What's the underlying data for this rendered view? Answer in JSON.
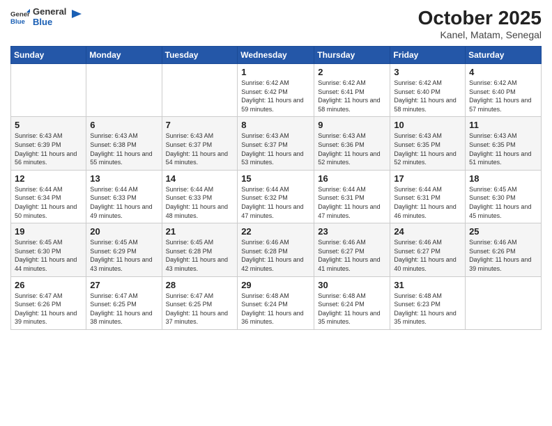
{
  "logo": {
    "general": "General",
    "blue": "Blue"
  },
  "title": "October 2025",
  "location": "Kanel, Matam, Senegal",
  "weekdays": [
    "Sunday",
    "Monday",
    "Tuesday",
    "Wednesday",
    "Thursday",
    "Friday",
    "Saturday"
  ],
  "weeks": [
    [
      {
        "day": "",
        "info": ""
      },
      {
        "day": "",
        "info": ""
      },
      {
        "day": "",
        "info": ""
      },
      {
        "day": "1",
        "info": "Sunrise: 6:42 AM\nSunset: 6:42 PM\nDaylight: 11 hours and 59 minutes."
      },
      {
        "day": "2",
        "info": "Sunrise: 6:42 AM\nSunset: 6:41 PM\nDaylight: 11 hours and 58 minutes."
      },
      {
        "day": "3",
        "info": "Sunrise: 6:42 AM\nSunset: 6:40 PM\nDaylight: 11 hours and 58 minutes."
      },
      {
        "day": "4",
        "info": "Sunrise: 6:42 AM\nSunset: 6:40 PM\nDaylight: 11 hours and 57 minutes."
      }
    ],
    [
      {
        "day": "5",
        "info": "Sunrise: 6:43 AM\nSunset: 6:39 PM\nDaylight: 11 hours and 56 minutes."
      },
      {
        "day": "6",
        "info": "Sunrise: 6:43 AM\nSunset: 6:38 PM\nDaylight: 11 hours and 55 minutes."
      },
      {
        "day": "7",
        "info": "Sunrise: 6:43 AM\nSunset: 6:37 PM\nDaylight: 11 hours and 54 minutes."
      },
      {
        "day": "8",
        "info": "Sunrise: 6:43 AM\nSunset: 6:37 PM\nDaylight: 11 hours and 53 minutes."
      },
      {
        "day": "9",
        "info": "Sunrise: 6:43 AM\nSunset: 6:36 PM\nDaylight: 11 hours and 52 minutes."
      },
      {
        "day": "10",
        "info": "Sunrise: 6:43 AM\nSunset: 6:35 PM\nDaylight: 11 hours and 52 minutes."
      },
      {
        "day": "11",
        "info": "Sunrise: 6:43 AM\nSunset: 6:35 PM\nDaylight: 11 hours and 51 minutes."
      }
    ],
    [
      {
        "day": "12",
        "info": "Sunrise: 6:44 AM\nSunset: 6:34 PM\nDaylight: 11 hours and 50 minutes."
      },
      {
        "day": "13",
        "info": "Sunrise: 6:44 AM\nSunset: 6:33 PM\nDaylight: 11 hours and 49 minutes."
      },
      {
        "day": "14",
        "info": "Sunrise: 6:44 AM\nSunset: 6:33 PM\nDaylight: 11 hours and 48 minutes."
      },
      {
        "day": "15",
        "info": "Sunrise: 6:44 AM\nSunset: 6:32 PM\nDaylight: 11 hours and 47 minutes."
      },
      {
        "day": "16",
        "info": "Sunrise: 6:44 AM\nSunset: 6:31 PM\nDaylight: 11 hours and 47 minutes."
      },
      {
        "day": "17",
        "info": "Sunrise: 6:44 AM\nSunset: 6:31 PM\nDaylight: 11 hours and 46 minutes."
      },
      {
        "day": "18",
        "info": "Sunrise: 6:45 AM\nSunset: 6:30 PM\nDaylight: 11 hours and 45 minutes."
      }
    ],
    [
      {
        "day": "19",
        "info": "Sunrise: 6:45 AM\nSunset: 6:30 PM\nDaylight: 11 hours and 44 minutes."
      },
      {
        "day": "20",
        "info": "Sunrise: 6:45 AM\nSunset: 6:29 PM\nDaylight: 11 hours and 43 minutes."
      },
      {
        "day": "21",
        "info": "Sunrise: 6:45 AM\nSunset: 6:28 PM\nDaylight: 11 hours and 43 minutes."
      },
      {
        "day": "22",
        "info": "Sunrise: 6:46 AM\nSunset: 6:28 PM\nDaylight: 11 hours and 42 minutes."
      },
      {
        "day": "23",
        "info": "Sunrise: 6:46 AM\nSunset: 6:27 PM\nDaylight: 11 hours and 41 minutes."
      },
      {
        "day": "24",
        "info": "Sunrise: 6:46 AM\nSunset: 6:27 PM\nDaylight: 11 hours and 40 minutes."
      },
      {
        "day": "25",
        "info": "Sunrise: 6:46 AM\nSunset: 6:26 PM\nDaylight: 11 hours and 39 minutes."
      }
    ],
    [
      {
        "day": "26",
        "info": "Sunrise: 6:47 AM\nSunset: 6:26 PM\nDaylight: 11 hours and 39 minutes."
      },
      {
        "day": "27",
        "info": "Sunrise: 6:47 AM\nSunset: 6:25 PM\nDaylight: 11 hours and 38 minutes."
      },
      {
        "day": "28",
        "info": "Sunrise: 6:47 AM\nSunset: 6:25 PM\nDaylight: 11 hours and 37 minutes."
      },
      {
        "day": "29",
        "info": "Sunrise: 6:48 AM\nSunset: 6:24 PM\nDaylight: 11 hours and 36 minutes."
      },
      {
        "day": "30",
        "info": "Sunrise: 6:48 AM\nSunset: 6:24 PM\nDaylight: 11 hours and 35 minutes."
      },
      {
        "day": "31",
        "info": "Sunrise: 6:48 AM\nSunset: 6:23 PM\nDaylight: 11 hours and 35 minutes."
      },
      {
        "day": "",
        "info": ""
      }
    ]
  ]
}
